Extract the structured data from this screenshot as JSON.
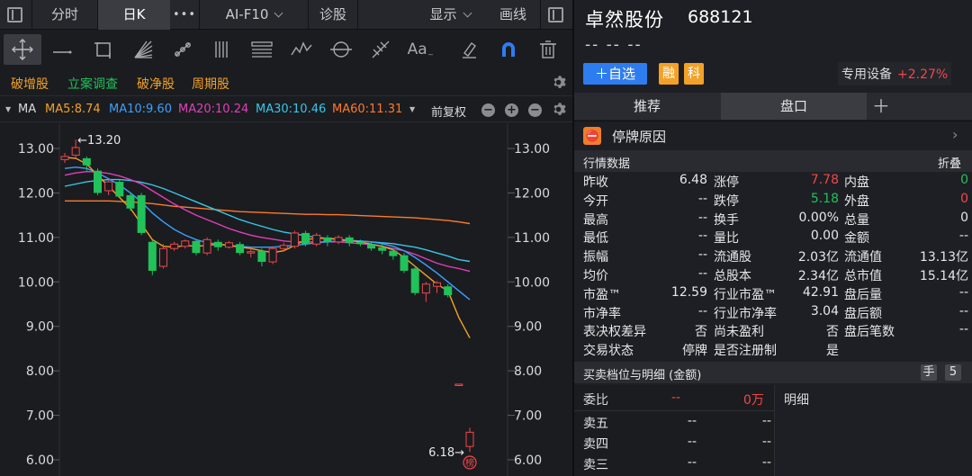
{
  "tabs": {
    "fenshi": "分时",
    "rik": "日K",
    "more": "•••",
    "aif10": "AI-F10",
    "zhengu": "诊股",
    "xianshi": "显示",
    "huaxian": "画线"
  },
  "tags": [
    {
      "label": "破增股",
      "color": "#f2a227"
    },
    {
      "label": "立案调查",
      "color": "#21c25a"
    },
    {
      "label": "破净股",
      "color": "#f2a227"
    },
    {
      "label": "周期股",
      "color": "#f2a227"
    }
  ],
  "ma": {
    "label": "MA",
    "ma5": "MA5:8.74",
    "ma10": "MA10:9.60",
    "ma20": "MA20:10.24",
    "ma30": "MA30:10.46",
    "ma60": "MA60:11.31",
    "fq": "前复权",
    "colors": {
      "ma5": "#f2a227",
      "ma10": "#3aa0ff",
      "ma20": "#e040b8",
      "ma30": "#37c7e8",
      "ma60": "#ff7a29"
    }
  },
  "chart_data": {
    "type": "candlestick",
    "yticks": [
      "13.00",
      "12.00",
      "11.00",
      "10.00",
      "9.00",
      "8.00",
      "7.00",
      "6.00"
    ],
    "ylim": [
      5.85,
      13.55
    ],
    "high_label": "←13.20",
    "high_value": 13.2,
    "low_label": "6.18→",
    "low_value": 6.18,
    "badge": "榜",
    "candles": [
      [
        12.75,
        12.82,
        12.68,
        12.9
      ],
      [
        12.85,
        13.02,
        12.8,
        13.2
      ],
      [
        12.78,
        12.62,
        12.5,
        12.82
      ],
      [
        12.5,
        12.0,
        11.95,
        12.55
      ],
      [
        12.05,
        12.25,
        11.95,
        12.3
      ],
      [
        12.25,
        11.92,
        11.9,
        12.3
      ],
      [
        11.95,
        11.65,
        11.6,
        12.0
      ],
      [
        11.95,
        11.1,
        11.05,
        12.0
      ],
      [
        10.9,
        10.25,
        10.15,
        10.95
      ],
      [
        10.35,
        10.75,
        10.3,
        10.85
      ],
      [
        10.75,
        10.85,
        10.7,
        10.9
      ],
      [
        10.8,
        10.92,
        10.75,
        10.95
      ],
      [
        10.92,
        10.65,
        10.6,
        10.95
      ],
      [
        10.65,
        10.95,
        10.6,
        11.0
      ],
      [
        10.9,
        10.78,
        10.7,
        10.95
      ],
      [
        10.78,
        10.88,
        10.75,
        10.92
      ],
      [
        10.85,
        10.65,
        10.6,
        10.9
      ],
      [
        10.65,
        10.68,
        10.55,
        10.75
      ],
      [
        10.7,
        10.45,
        10.35,
        10.75
      ],
      [
        10.45,
        10.75,
        10.4,
        10.8
      ],
      [
        10.75,
        10.82,
        10.7,
        10.88
      ],
      [
        10.8,
        11.1,
        10.75,
        11.15
      ],
      [
        11.1,
        10.85,
        10.8,
        11.15
      ],
      [
        10.85,
        11.05,
        10.8,
        11.1
      ],
      [
        11.0,
        10.9,
        10.8,
        11.05
      ],
      [
        10.9,
        11.0,
        10.85,
        11.05
      ],
      [
        11.0,
        10.88,
        10.8,
        11.05
      ],
      [
        10.9,
        10.85,
        10.8,
        10.95
      ],
      [
        10.85,
        10.75,
        10.7,
        10.9
      ],
      [
        10.78,
        10.7,
        10.62,
        10.85
      ],
      [
        10.7,
        10.58,
        10.5,
        10.75
      ],
      [
        10.6,
        10.25,
        10.2,
        10.65
      ],
      [
        10.3,
        9.75,
        9.7,
        10.35
      ],
      [
        9.75,
        9.95,
        9.55,
        10.0
      ],
      [
        9.9,
        9.98,
        9.75,
        10.02
      ],
      [
        9.9,
        9.7,
        9.65,
        9.95
      ],
      [
        7.7,
        7.7,
        7.7,
        7.7
      ],
      [
        6.3,
        6.62,
        6.18,
        6.72
      ]
    ],
    "ma5": [
      12.8,
      12.78,
      12.65,
      12.4,
      12.15,
      11.9,
      11.65,
      11.3,
      10.95,
      10.8,
      10.78,
      10.82,
      10.8,
      10.82,
      10.85,
      10.82,
      10.78,
      10.75,
      10.7,
      10.66,
      10.7,
      10.82,
      10.95,
      10.98,
      10.98,
      10.96,
      10.93,
      10.9,
      10.85,
      10.8,
      10.72,
      10.55,
      10.35,
      10.15,
      9.95,
      9.8,
      9.2,
      8.74
    ],
    "ma10": [
      12.55,
      12.58,
      12.55,
      12.45,
      12.32,
      12.18,
      12.0,
      11.8,
      11.55,
      11.35,
      11.18,
      11.05,
      10.95,
      10.88,
      10.85,
      10.82,
      10.8,
      10.78,
      10.78,
      10.78,
      10.8,
      10.82,
      10.85,
      10.88,
      10.9,
      10.92,
      10.93,
      10.92,
      10.9,
      10.86,
      10.8,
      10.7,
      10.55,
      10.38,
      10.2,
      10.0,
      9.8,
      9.6
    ],
    "ma20": [
      12.4,
      12.45,
      12.48,
      12.47,
      12.44,
      12.38,
      12.3,
      12.2,
      12.05,
      11.9,
      11.75,
      11.62,
      11.5,
      11.4,
      11.3,
      11.2,
      11.12,
      11.05,
      11.0,
      10.96,
      10.92,
      10.9,
      10.9,
      10.9,
      10.9,
      10.9,
      10.88,
      10.86,
      10.84,
      10.8,
      10.75,
      10.7,
      10.62,
      10.52,
      10.42,
      10.35,
      10.3,
      10.24
    ],
    "ma30": [
      12.15,
      12.2,
      12.25,
      12.28,
      12.3,
      12.3,
      12.28,
      12.24,
      12.18,
      12.1,
      12.0,
      11.9,
      11.8,
      11.7,
      11.6,
      11.5,
      11.4,
      11.32,
      11.25,
      11.18,
      11.12,
      11.08,
      11.04,
      11.0,
      10.98,
      10.95,
      10.93,
      10.92,
      10.9,
      10.88,
      10.86,
      10.82,
      10.78,
      10.72,
      10.65,
      10.58,
      10.5,
      10.46
    ],
    "ma60": [
      11.82,
      11.82,
      11.82,
      11.82,
      11.82,
      11.81,
      11.8,
      11.78,
      11.76,
      11.73,
      11.7,
      11.68,
      11.66,
      11.64,
      11.62,
      11.6,
      11.58,
      11.57,
      11.56,
      11.55,
      11.54,
      11.53,
      11.52,
      11.52,
      11.51,
      11.51,
      11.5,
      11.49,
      11.48,
      11.47,
      11.46,
      11.45,
      11.44,
      11.42,
      11.4,
      11.38,
      11.35,
      11.31
    ]
  },
  "stock": {
    "name": "卓然股份",
    "code": "688121",
    "dash": "-- -- --",
    "add_btn": "＋自选",
    "badge1": "融",
    "badge2": "科",
    "industry": "专用设备",
    "change": "+2.27%"
  },
  "ptabs": {
    "tab1": "推荐",
    "tab2": "盘口",
    "plus": "＋"
  },
  "halt": {
    "label": "停牌原因",
    "icon": "⛔"
  },
  "quote": {
    "title": "行情数据",
    "fold": "折叠",
    "rows": [
      [
        [
          "昨收",
          "6.48",
          ""
        ],
        [
          "涨停",
          "7.78",
          "red"
        ],
        [
          "内盘",
          "0",
          "grn"
        ]
      ],
      [
        [
          "今开",
          "--",
          ""
        ],
        [
          "跌停",
          "5.18",
          "grn"
        ],
        [
          "外盘",
          "0",
          "red"
        ]
      ],
      [
        [
          "最高",
          "--",
          ""
        ],
        [
          "换手",
          "0.00%",
          ""
        ],
        [
          "总量",
          "0",
          ""
        ]
      ],
      [
        [
          "最低",
          "--",
          ""
        ],
        [
          "量比",
          "0.00",
          ""
        ],
        [
          "金额",
          "--",
          ""
        ]
      ],
      [
        [
          "振幅",
          "--",
          ""
        ],
        [
          "流通股",
          "2.03亿",
          ""
        ],
        [
          "流通值",
          "13.13亿",
          ""
        ]
      ],
      [
        [
          "均价",
          "--",
          ""
        ],
        [
          "总股本",
          "2.34亿",
          ""
        ],
        [
          "总市值",
          "15.14亿",
          ""
        ]
      ],
      [
        [
          "市盈™",
          "12.59",
          ""
        ],
        [
          "行业市盈™",
          "42.91",
          ""
        ],
        [
          "盘后量",
          "--",
          ""
        ]
      ],
      [
        [
          "市净率",
          "--",
          ""
        ],
        [
          "行业市净率",
          "3.04",
          ""
        ],
        [
          "盘后额",
          "--",
          ""
        ]
      ],
      [
        [
          "表决权差异",
          "否",
          ""
        ],
        [
          "尚未盈利",
          "否",
          ""
        ],
        [
          "盘后笔数",
          "--",
          ""
        ]
      ],
      [
        [
          "交易状态",
          "停牌",
          ""
        ],
        [
          "是否注册制",
          "是",
          ""
        ],
        [
          "",
          "",
          ""
        ]
      ]
    ]
  },
  "book": {
    "title": "买卖档位与明细 (金额)",
    "hand": "手",
    "five": "5",
    "weibi": "委比",
    "wb_val": "--",
    "wb_amt": "0万",
    "mingxi": "明细",
    "levels": [
      [
        "卖五",
        "--",
        "--"
      ],
      [
        "卖四",
        "--",
        "--"
      ],
      [
        "卖三",
        "--",
        "--"
      ]
    ]
  }
}
